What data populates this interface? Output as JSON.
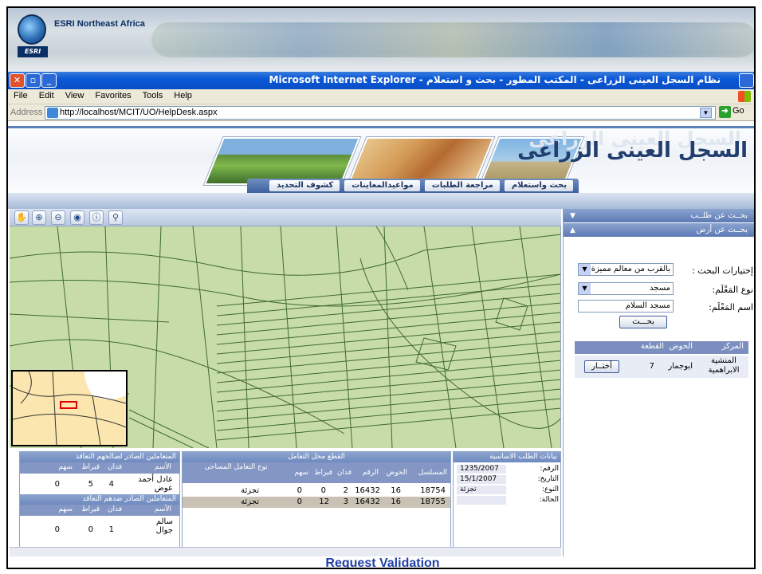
{
  "banner": {
    "company": "ESRI Northeast Africa",
    "logo_text": "ESRI"
  },
  "window": {
    "title": "نظام السجل العينى الزراعى - المكتب المطور - بحث و استعلام - Microsoft Internet Explorer",
    "minimize": "_",
    "maximize": "▫",
    "close": "✕"
  },
  "menu": [
    "File",
    "Edit",
    "View",
    "Favorites",
    "Tools",
    "Help"
  ],
  "address": {
    "label": "Address",
    "url": "http://localhost/MCIT/UO/HelpDesk.aspx",
    "go": "Go"
  },
  "app": {
    "title": "السجل العينى الزراعى",
    "tabs": [
      "بحث واستعلام",
      "مراجعة الطلبات",
      "مواعيدالمعاينات",
      "كشوف التحديد"
    ]
  },
  "map_tools": [
    "pan-icon",
    "zoom-in-icon",
    "zoom-out-icon",
    "full-extent-icon",
    "identify-icon",
    "find-icon"
  ],
  "right_panel": {
    "section1": "بحــث عن طلــب",
    "section2": "بحــث عن أرض",
    "search_options_label": "إختيارات البحث :",
    "search_options_value": "بالقرب من معالم مميزة",
    "landmark_type_label": "نوع المَعْلَم:",
    "landmark_type_value": "مسجد",
    "landmark_name_label": "اسم المَعْلَم:",
    "landmark_name_value": "مسجد السلام",
    "search_button": "بحـــث",
    "results_headers": [
      "المركز",
      "الحوض",
      "القطعة"
    ],
    "results_rows": [
      {
        "center": "المنشية الابراهمية",
        "basin": "ابوجمار",
        "parcel": "7",
        "action": "أختــار"
      }
    ]
  },
  "basic_data": {
    "title": "بيانات الطلب الاساسية",
    "fields": [
      {
        "k": "الرقم:",
        "v": "1235/2007"
      },
      {
        "k": "التاريخ:",
        "v": "15/1/2007"
      },
      {
        "k": "النوع:",
        "v": "تجزئة"
      },
      {
        "k": "الحالة:",
        "v": ""
      }
    ]
  },
  "parcels": {
    "title": "القطع محل التعامل",
    "headers": [
      "المسلسل",
      "الحوض",
      "الرقم",
      "فدان",
      "قيراط",
      "سهم",
      "نوع التعامل المساحى"
    ],
    "rows": [
      [
        "18754",
        "16",
        "16432",
        "2",
        "0",
        "0",
        "تجزئة"
      ],
      [
        "18755",
        "16",
        "16432",
        "3",
        "12",
        "0",
        "تجزئة"
      ]
    ]
  },
  "parties": {
    "title1": "المتعاملين الصادر لصالحهم التعاقد",
    "title2": "المتعاملين الصادر ضدهم التعاقد",
    "headers": [
      "الأسم",
      "فدان",
      "قيراط",
      "سهم"
    ],
    "rows1": [
      [
        "عادل أحمد عوض",
        "4",
        "5",
        "0"
      ]
    ],
    "rows2": [
      [
        "سالم جوال",
        "1",
        "0",
        "0"
      ]
    ]
  },
  "caption": "Request Validation"
}
